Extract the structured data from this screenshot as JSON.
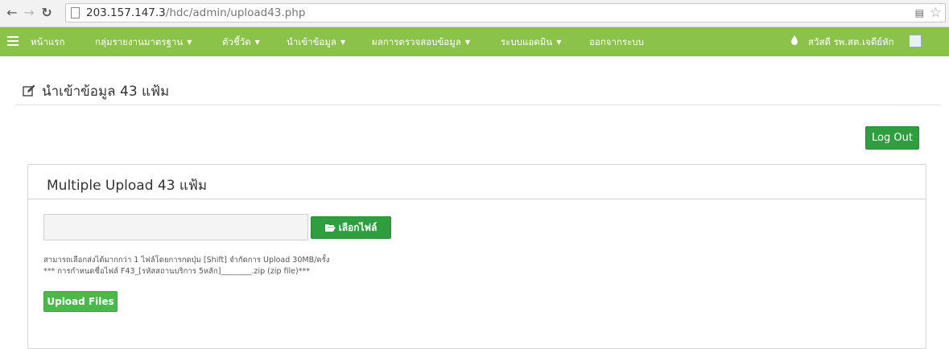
{
  "browser": {
    "url_host": "203.157.147.3",
    "url_path": "/hdc/admin/upload43.php",
    "back_icon": "back-arrow-icon",
    "forward_icon": "forward-arrow-icon",
    "reload_icon": "reload-icon"
  },
  "navbar": {
    "bg_color": "#8bc34a",
    "items": [
      {
        "label": "หน้าแรก",
        "dropdown": false
      },
      {
        "label": "กลุ่มรายงานมาตรฐาน",
        "dropdown": true
      },
      {
        "label": "ตัวชี้วัด",
        "dropdown": true
      },
      {
        "label": "นำเข้าข้อมูล",
        "dropdown": true
      },
      {
        "label": "ผลการตรวจสอบข้อมูล",
        "dropdown": true
      },
      {
        "label": "ระบบแอดมิน",
        "dropdown": true
      },
      {
        "label": "ออกจากระบบ",
        "dropdown": false
      }
    ],
    "greeting": "สวัสดี รพ.สต.เจดีย์หัก"
  },
  "page": {
    "title": "นำเข้าข้อมูล 43 แฟ้ม",
    "logout_label": "Log Out"
  },
  "panel": {
    "title": "Multiple Upload 43 แฟ้ม",
    "file_value": "",
    "choose_label": "เลือกไฟล์",
    "help_line1": "สามารถเลือกส่งได้มากกว่า 1 ไฟล์โดยการกดปุ่ม [Shift] จำกัดการ Upload 30MB/ครั้ง",
    "help_line2": "*** การกำหนดชื่อไฟล์ F43_[รหัสสถานบริการ 5หลัก]________.zip (zip file)***",
    "upload_label": "Upload Files"
  },
  "colors": {
    "primary_green": "#2e9e3e",
    "upload_green": "#4bb84b"
  }
}
